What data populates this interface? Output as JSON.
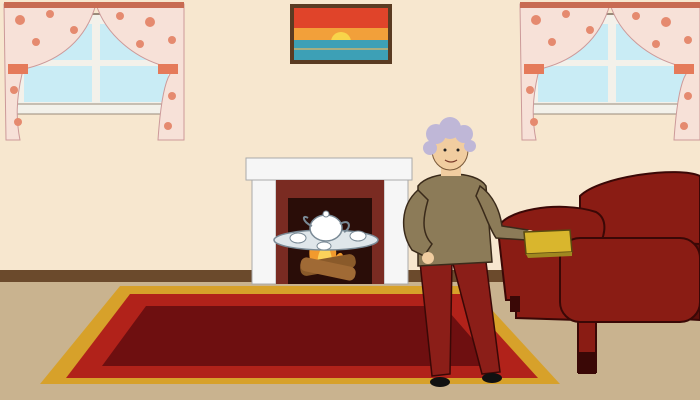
{
  "scene": {
    "name": "living-room",
    "colors": {
      "wall": "#f7e7cf",
      "wall_shade": "#efd6b6",
      "floor": "#c9b38f",
      "baseboard": "#6b4a2c",
      "curtain": "#f7e1d8",
      "curtain_flower": "#e58a6f",
      "window_glass": "#c9ecf5",
      "window_frame": "#f3f1ea",
      "rug_border": "#b1221a",
      "rug_inner": "#6e0f10",
      "rug_fringe": "#d7a12a",
      "sofa": "#8a1c14",
      "sofa_dark": "#5e0f0b",
      "fireplace": "#f6f6f6",
      "fireplace_inner": "#7a2b22",
      "fire": "#f19a2d",
      "grandma_sweater": "#8c7b58",
      "grandma_pants": "#8b1e18",
      "grandma_skin": "#f1cda0",
      "grandma_hair": "#bfb7d7",
      "book": "#d9b62d"
    },
    "painting": {
      "sky_top": "#e0442a",
      "sky_mid": "#f2a03a",
      "sea": "#3da0b6",
      "sun": "#f8d44a"
    },
    "icons": [
      "window",
      "curtain",
      "painting",
      "fireplace",
      "teapot",
      "teacup",
      "rug",
      "sofa",
      "grandma",
      "book"
    ]
  }
}
